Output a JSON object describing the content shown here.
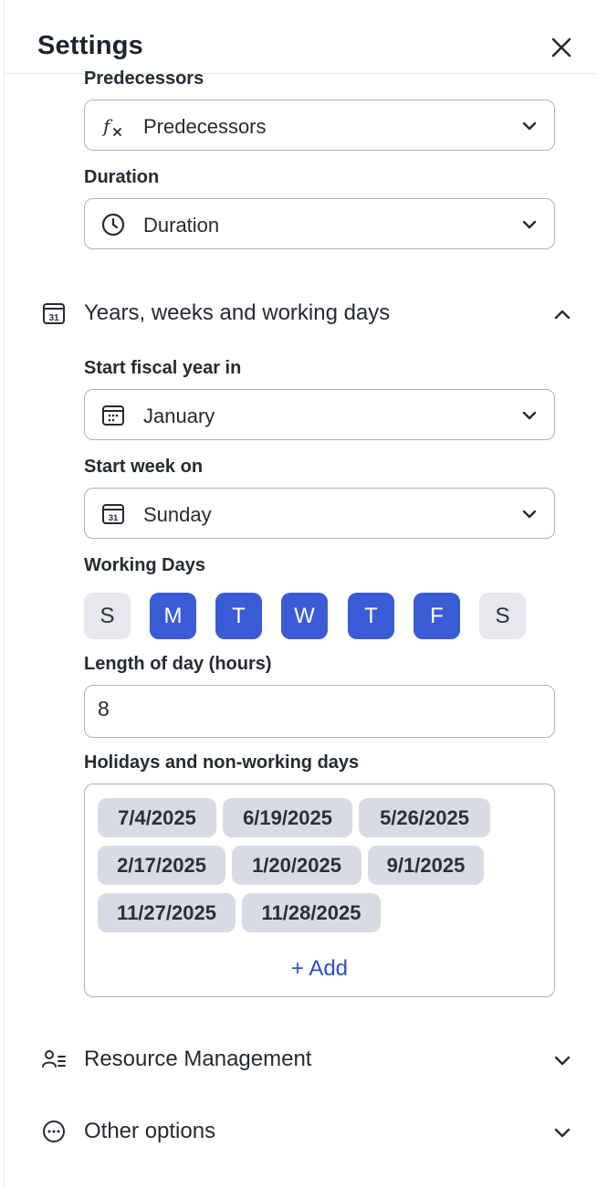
{
  "header": {
    "title": "Settings"
  },
  "fields": {
    "predecessors": {
      "label": "Predecessors",
      "value": "Predecessors"
    },
    "duration": {
      "label": "Duration",
      "value": "Duration"
    }
  },
  "sections": {
    "years": {
      "title": "Years, weeks and working days",
      "start_fiscal": {
        "label": "Start fiscal year in",
        "value": "January"
      },
      "start_week": {
        "label": "Start week on",
        "value": "Sunday",
        "icon_number": "31"
      },
      "working_days": {
        "label": "Working Days",
        "days": [
          {
            "letter": "S",
            "active": false
          },
          {
            "letter": "M",
            "active": true
          },
          {
            "letter": "T",
            "active": true
          },
          {
            "letter": "W",
            "active": true
          },
          {
            "letter": "T",
            "active": true
          },
          {
            "letter": "F",
            "active": true
          },
          {
            "letter": "S",
            "active": false
          }
        ]
      },
      "day_length": {
        "label": "Length of day (hours)",
        "value": "8"
      },
      "holidays": {
        "label": "Holidays and non-working days",
        "dates": [
          "7/4/2025",
          "6/19/2025",
          "5/26/2025",
          "2/17/2025",
          "1/20/2025",
          "9/1/2025",
          "11/27/2025",
          "11/28/2025"
        ],
        "add_label": "+ Add"
      },
      "calendar_icon_number": "31"
    },
    "resource": {
      "title": "Resource Management"
    },
    "other": {
      "title": "Other options"
    }
  },
  "colors": {
    "accent": "#3a5bd6",
    "chip": "#d9dbe4",
    "day_off": "#e6e8ee",
    "link": "#2f4fc7"
  }
}
